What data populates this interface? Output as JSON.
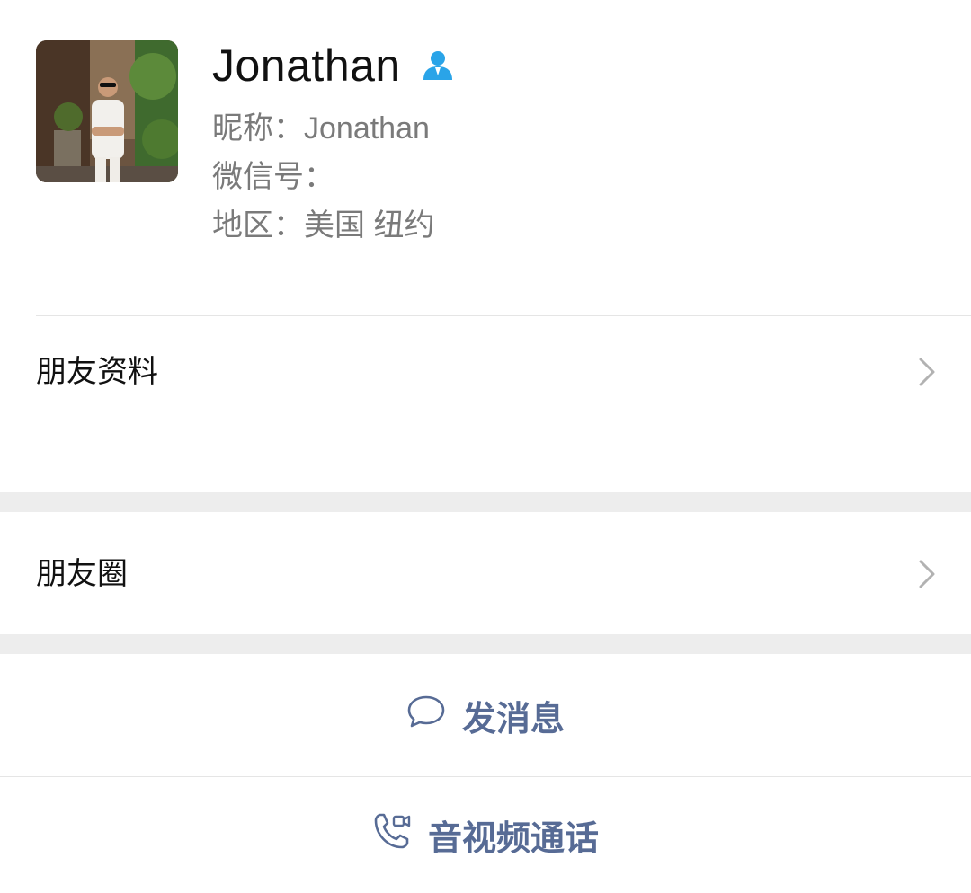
{
  "profile": {
    "display_name": "Jonathan",
    "nickname_label": "昵称：",
    "nickname": "Jonathan",
    "wechat_id_label": "微信号：",
    "region_label": "地区：",
    "region": "美国 纽约",
    "contact_icon": "person-icon"
  },
  "rows": {
    "friend_profile": "朋友资料",
    "moments": "朋友圈"
  },
  "actions": {
    "send_message": "发消息",
    "voice_video_call": "音视频通话"
  },
  "colors": {
    "accent_link": "#576b95",
    "contact_icon_blue": "#2aa4e8",
    "section_gap": "#ededed",
    "secondary_text": "#7a7a7a"
  }
}
